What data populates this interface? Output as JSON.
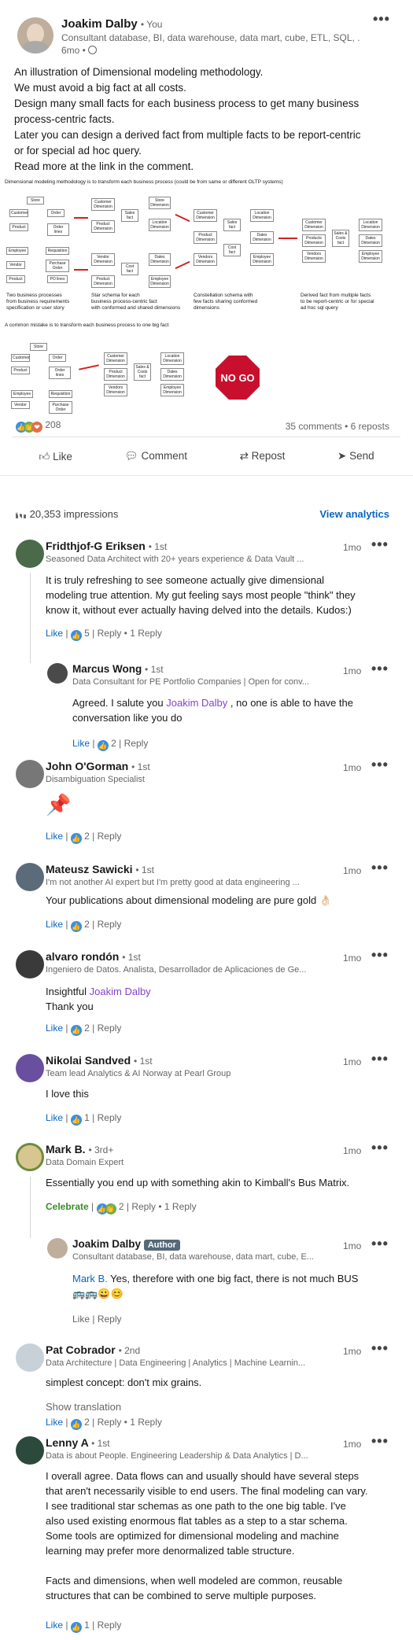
{
  "post": {
    "author": "Joakim Dalby",
    "degree": "• You",
    "headline": "Consultant database, BI, data warehouse, data mart, cube, ETL, SQL, ...",
    "time": "6mo •",
    "body": [
      "An illustration of Dimensional modeling methodology.",
      "We must avoid a big fact at all costs.",
      "Design many small facts for each business process to get many business",
      "process-centric facts.",
      "Later you can design a derived fact from multiple facts to be report-centric",
      "or for special ad hoc query.",
      "Read more at the link in the comment."
    ],
    "figure": {
      "title1": "Dimensional modeling methodology is to transform each business process (could be from same or different OLTP systems)",
      "title2": "A common mistake is to transform each business process to one big fact",
      "cap1": "Two business processes\nfrom business requirements\nspecification or user story",
      "cap2": "Star schema for each\nbusiness process-centric fact\nwith conformed and shared dimensions",
      "cap3": "Constellation schema with\nfew facts sharing conformed\ndimensions",
      "cap4": "Derived fact from multiple facts\nto be report-centric or for special\nad hoc sql query",
      "nogo": "NO GO"
    },
    "reactions_count": "208",
    "comments_reposts": "35 comments • 6 reposts",
    "actions": [
      "Like",
      "Comment",
      "Repost",
      "Send"
    ],
    "impressions": "20,353 impressions",
    "view_analytics": "View analytics"
  },
  "comments": [
    {
      "name": "Fridthjof-G Eriksen",
      "degree": "• 1st",
      "headline": "Seasoned Data Architect with 20+ years experience & Data Vault ...",
      "time": "1mo",
      "text": [
        "It is truly refreshing to see someone actually give dimensional",
        "modeling true attention. My gut feeling says most people \"think\" they",
        "know it, without ever actually having delved into the details. Kudos:)"
      ],
      "like": "Like",
      "count": "5",
      "reply": "Reply",
      "replies": "1 Reply"
    },
    {
      "name": "Marcus Wong",
      "degree": "• 1st",
      "headline": "Data Consultant for PE Portfolio Companies | Open for conv...",
      "time": "1mo",
      "pre": "Agreed. I salute you ",
      "mention": "Joakim Dalby",
      "post": " , no one is able to have the",
      "text2": "conversation like you do",
      "like": "Like",
      "count": "2",
      "reply": "Reply"
    },
    {
      "name": "John O'Gorman",
      "degree": "• 1st",
      "headline": "Disambiguation Specialist",
      "time": "1mo",
      "emoji": "📌",
      "like": "Like",
      "count": "2",
      "reply": "Reply"
    },
    {
      "name": "Mateusz Sawicki",
      "degree": "• 1st",
      "headline": "I'm not another AI expert but I'm pretty good at data engineering ...",
      "time": "1mo",
      "text": [
        "Your publications about dimensional modeling are pure gold 👌🏻"
      ],
      "like": "Like",
      "count": "2",
      "reply": "Reply"
    },
    {
      "name": "alvaro rondón",
      "degree": "• 1st",
      "headline": "Ingeniero de Datos. Analista, Desarrollador de Aplicaciones de Ge...",
      "time": "1mo",
      "pre": "Insightful ",
      "mention": "Joakim Dalby",
      "text2": "Thank you",
      "like": "Like",
      "count": "2",
      "reply": "Reply"
    },
    {
      "name": "Nikolai Sandved",
      "degree": "• 1st",
      "headline": "Team lead Analytics & AI Norway at Pearl Group",
      "time": "1mo",
      "text": [
        "I love this"
      ],
      "like": "Like",
      "count": "1",
      "reply": "Reply"
    },
    {
      "name": "Mark B.",
      "degree": "• 3rd+",
      "headline": "Data Domain Expert",
      "time": "1mo",
      "text": [
        "Essentially you end up with something akin to Kimball's Bus Matrix."
      ],
      "like": "Celebrate",
      "count": "2",
      "reply": "Reply",
      "replies": "1 Reply"
    },
    {
      "name": "Joakim Dalby",
      "badge": "Author",
      "headline": "Consultant database, BI, data warehouse, data mart, cube, E...",
      "time": "1mo",
      "mention": "Mark B.",
      "post": " Yes, therefore with one big fact, there is not much BUS",
      "text2": "🚌🚌😀😊",
      "like": "Like",
      "reply": "Reply"
    },
    {
      "name": "Pat Cobrador",
      "degree": "• 2nd",
      "headline": "Data Architecture | Data Engineering | Analytics | Machine Learnin...",
      "time": "1mo",
      "text": [
        "simplest concept: don't mix grains."
      ],
      "translate": "Show translation",
      "like": "Like",
      "count": "2",
      "reply": "Reply",
      "replies": "1 Reply"
    },
    {
      "name": "Lenny A",
      "degree": "• 1st",
      "headline": "Data is about People. Engineering Leadership & Data Analytics | D...",
      "time": "1mo",
      "text": [
        "I overall agree. Data flows can and usually should have several steps",
        "that aren't necessarily visible to end users. The final modeling can vary.",
        "I see traditional star schemas as one path to the one big table. I've",
        "also used existing enormous flat tables as a step to a star schema.",
        "Some tools are optimized for dimensional modeling and machine",
        "learning may prefer more denormalized table structure.",
        "",
        "Facts and dimensions, when well modeled are common, reusable",
        "structures that can be combined to serve multiple purposes."
      ],
      "like": "Like",
      "count": "1",
      "reply": "Reply"
    }
  ]
}
